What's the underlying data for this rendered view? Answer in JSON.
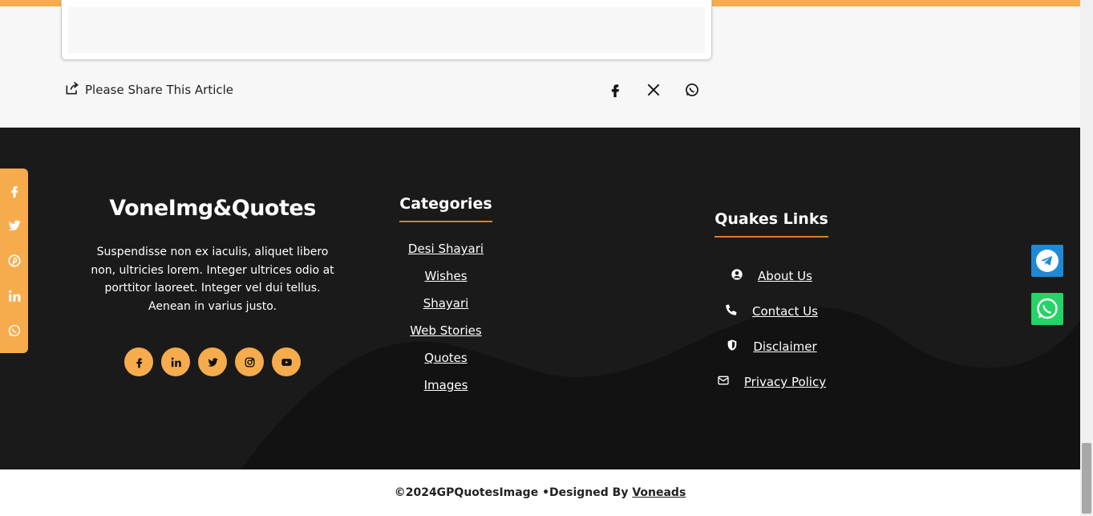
{
  "share": {
    "label": "Please Share This Article",
    "icons": [
      "facebook-icon",
      "x-icon",
      "whatsapp-icon"
    ]
  },
  "footer": {
    "brand": {
      "title": "VoneImg&Quotes",
      "description": "Suspendisse non ex iaculis, aliquet libero non, ultricies lorem. Integer ultrices odio at porttitor laoreet. Integer vel dui tellus. Aenean in varius justo.",
      "social": [
        "facebook-icon",
        "linkedin-icon",
        "twitter-icon",
        "instagram-icon",
        "youtube-icon"
      ]
    },
    "categories": {
      "heading": "Categories",
      "items": [
        "Desi Shayari",
        "Wishes",
        "Shayari",
        "Web Stories",
        "Quotes",
        "Images"
      ]
    },
    "quick_links": {
      "heading": "Quakes Links",
      "items": [
        {
          "label": "About Us",
          "icon": "user-circle-icon"
        },
        {
          "label": "Contact Us",
          "icon": "phone-icon"
        },
        {
          "label": "Disclaimer",
          "icon": "shield-icon"
        },
        {
          "label": "Privacy Policy",
          "icon": "envelope-icon"
        }
      ]
    }
  },
  "side_share": [
    "facebook-icon",
    "twitter-icon",
    "pinterest-icon",
    "linkedin-icon",
    "whatsapp-icon"
  ],
  "floating": [
    "telegram-icon",
    "whatsapp-icon"
  ],
  "bottom": {
    "copyright": "©2024GPQuotesImage •Designed By",
    "designer": "Voneads"
  },
  "colors": {
    "accent": "#f6ac4c",
    "footer_bg": "#1a1a1a",
    "heading_underline": "#e07b26",
    "telegram": "#1e8ad6",
    "whatsapp": "#25d366"
  }
}
